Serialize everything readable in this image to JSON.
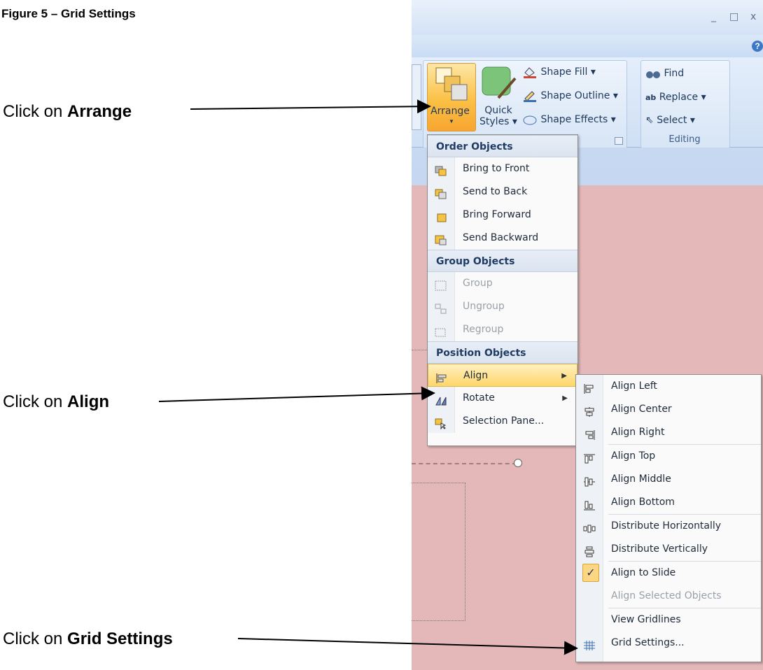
{
  "figure_title": "Figure 5 – Grid Settings",
  "callouts": [
    {
      "prefix": "Click on ",
      "bold": "Arrange"
    },
    {
      "prefix": "Click on ",
      "bold": "Align"
    },
    {
      "prefix": "Click on ",
      "bold": "Grid Settings"
    }
  ],
  "window": {
    "minimize": "_",
    "restore": "□",
    "close": "x",
    "help": "?"
  },
  "ribbon": {
    "arrange_label": "Arrange",
    "quick_styles_label_1": "Quick",
    "quick_styles_label_2": "Styles",
    "shape_fill": "Shape Fill",
    "shape_outline": "Shape Outline",
    "shape_effects": "Shape Effects",
    "find": "Find",
    "replace": "Replace",
    "select": "Select",
    "editing_group": "Editing"
  },
  "arrange_menu": {
    "order_header": "Order Objects",
    "order_items": [
      "Bring to Front",
      "Send to Back",
      "Bring Forward",
      "Send Backward"
    ],
    "group_header": "Group Objects",
    "group_items": [
      "Group",
      "Ungroup",
      "Regroup"
    ],
    "position_header": "Position Objects",
    "position_items": [
      "Align",
      "Rotate",
      "Selection Pane..."
    ]
  },
  "align_menu": {
    "items": [
      "Align Left",
      "Align Center",
      "Align Right",
      "Align Top",
      "Align Middle",
      "Align Bottom",
      "Distribute Horizontally",
      "Distribute Vertically",
      "Align to Slide",
      "Align Selected Objects",
      "View Gridlines",
      "Grid Settings..."
    ],
    "check_mark": "✓"
  },
  "colors": {
    "slide_pink": "#e4b8b8",
    "ribbon_blue": "#cfdff4",
    "highlight_orange": "#ffd769"
  }
}
